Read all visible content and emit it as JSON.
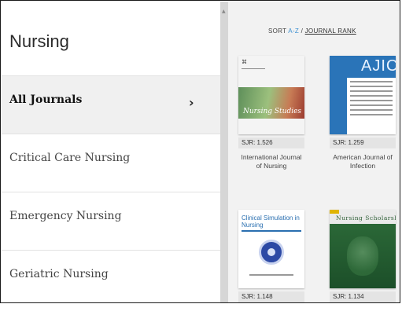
{
  "sidebar": {
    "title": "Nursing",
    "items": [
      {
        "label": "All Journals",
        "active": true,
        "chevron": "›"
      },
      {
        "label": "Critical Care Nursing",
        "active": false
      },
      {
        "label": "Emergency Nursing",
        "active": false
      },
      {
        "label": "Geriatric Nursing",
        "active": false
      }
    ]
  },
  "sort": {
    "prefix": "SORT",
    "az": "A-Z",
    "separator": "/",
    "rank": "JOURNAL RANK"
  },
  "journals": [
    {
      "sjr": "SJR: 1.526",
      "title": "International Journal of Nursing",
      "cover_text": "Nursing Studies"
    },
    {
      "sjr": "SJR: 1.259",
      "title": "American Journal of Infection",
      "cover_text": "AJIC"
    },
    {
      "sjr": "SJR: 1.148",
      "title": "",
      "cover_text": "Clinical Simulation in Nursing"
    },
    {
      "sjr": "SJR: 1.134",
      "title": "",
      "cover_text": "Nursing Scholarship"
    }
  ],
  "colors": {
    "accent_link": "#3b8fd1",
    "divider": "#d6d6d6",
    "active_item_bg": "#f0f0f0",
    "panel_bg": "#f2f2f2"
  }
}
